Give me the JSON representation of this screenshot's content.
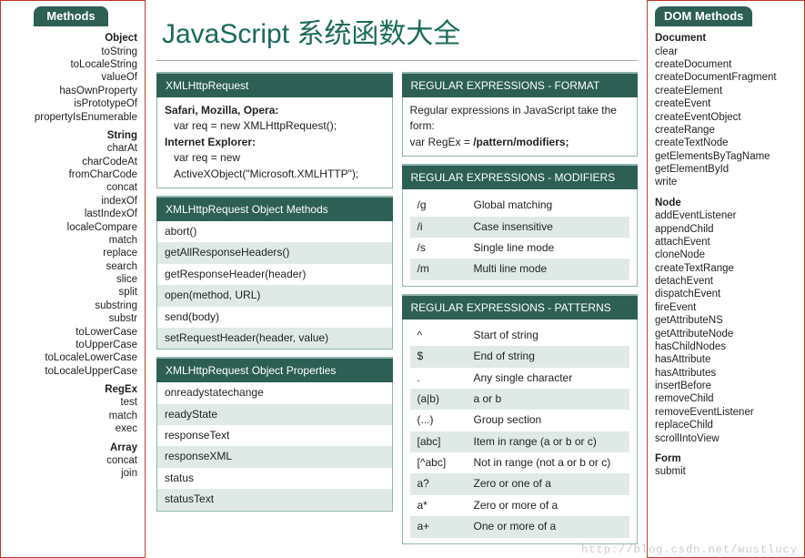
{
  "title": "JavaScript 系统函数大全",
  "watermark": "http://blog.csdn.net/wustlucy",
  "left": {
    "heading": "Methods",
    "groups": [
      {
        "name": "Object",
        "items": [
          "toString",
          "toLocaleString",
          "valueOf",
          "hasOwnProperty",
          "isPrototypeOf",
          "propertyIsEnumerable"
        ]
      },
      {
        "name": "String",
        "items": [
          "charAt",
          "charCodeAt",
          "fromCharCode",
          "concat",
          "indexOf",
          "lastIndexOf",
          "localeCompare",
          "match",
          "replace",
          "search",
          "slice",
          "split",
          "substring",
          "substr",
          "toLowerCase",
          "toUpperCase",
          "toLocaleLowerCase",
          "toLocaleUpperCase"
        ]
      },
      {
        "name": "RegEx",
        "items": [
          "test",
          "match",
          "exec"
        ]
      },
      {
        "name": "Array",
        "items": [
          "concat",
          "join"
        ]
      }
    ]
  },
  "right": {
    "heading": "DOM Methods",
    "groups": [
      {
        "name": "Document",
        "items": [
          "clear",
          "createDocument",
          "createDocumentFragment",
          "createElement",
          "createEvent",
          "createEventObject",
          "createRange",
          "createTextNode",
          "getElementsByTagName",
          "getElementById",
          "write"
        ]
      },
      {
        "name": "Node",
        "items": [
          "addEventListener",
          "appendChild",
          "attachEvent",
          "cloneNode",
          "createTextRange",
          "detachEvent",
          "dispatchEvent",
          "fireEvent",
          "getAttributeNS",
          "getAttributeNode",
          "hasChildNodes",
          "hasAttribute",
          "hasAttributes",
          "insertBefore",
          "removeChild",
          "removeEventListener",
          "replaceChild",
          "scrollIntoView"
        ]
      },
      {
        "name": "Form",
        "items": [
          "submit"
        ]
      }
    ]
  },
  "mid": {
    "left": {
      "xhr": {
        "heading": "XMLHttpRequest",
        "l1b": "Safari, Mozilla, Opera:",
        "l1": "var req = new XMLHttpRequest();",
        "l2b": "Internet Explorer:",
        "l2": "var req = new",
        "l3": "ActiveXObject(\"Microsoft.XMLHTTP\");"
      },
      "xhr_methods": {
        "heading": "XMLHttpRequest Object Methods",
        "items": [
          "abort()",
          "getAllResponseHeaders()",
          "getResponseHeader(header)",
          "open(method, URL)",
          "send(body)",
          "setRequestHeader(header, value)"
        ]
      },
      "xhr_props": {
        "heading": "XMLHttpRequest Object Properties",
        "items": [
          "onreadystatechange",
          "readyState",
          "responseText",
          "responseXML",
          "status",
          "statusText"
        ]
      }
    },
    "right": {
      "format": {
        "heading": "REGULAR EXPRESSIONS - FORMAT",
        "l1": "Regular expressions in JavaScript take the form:",
        "l2a": "var RegEx = ",
        "l2b": "/pattern/modifiers;"
      },
      "mods": {
        "heading": "REGULAR EXPRESSIONS - MODIFIERS",
        "rows": [
          {
            "k": "/g",
            "v": "Global matching"
          },
          {
            "k": "/i",
            "v": "Case insensitive"
          },
          {
            "k": "/s",
            "v": "Single line mode"
          },
          {
            "k": "/m",
            "v": "Multi line mode"
          }
        ]
      },
      "pats": {
        "heading": "REGULAR EXPRESSIONS - PATTERNS",
        "rows": [
          {
            "k": "^",
            "v": "Start of string"
          },
          {
            "k": "$",
            "v": "End of string"
          },
          {
            "k": ".",
            "v": "Any single character"
          },
          {
            "k": "(a|b)",
            "v": "a or b"
          },
          {
            "k": "(...)",
            "v": "Group section"
          },
          {
            "k": "[abc]",
            "v": "Item in range (a or b or c)"
          },
          {
            "k": "[^abc]",
            "v": "Not in range (not a or b or c)"
          },
          {
            "k": "a?",
            "v": "Zero or one of a"
          },
          {
            "k": "a*",
            "v": "Zero or more of a"
          },
          {
            "k": "a+",
            "v": "One or more of a"
          }
        ]
      }
    }
  }
}
